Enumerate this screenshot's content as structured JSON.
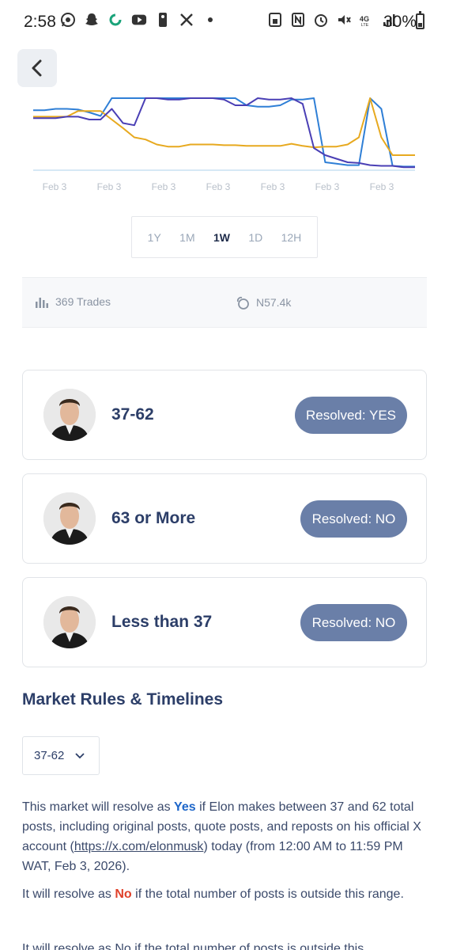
{
  "status": {
    "time": "2:58",
    "battery": "30%",
    "battery_level": 0.3,
    "left_icons": [
      "whatsapp-icon",
      "snapchat-icon",
      "sync-icon",
      "youtube-icon",
      "nba-icon",
      "x-icon",
      "dot-icon"
    ],
    "right_icons": [
      "save-icon",
      "nfc-icon",
      "alarm-icon",
      "mute-icon",
      "4g-icon",
      "signal-icon"
    ]
  },
  "back_icon": "chevron-left-icon",
  "chart_data": {
    "type": "line",
    "x_tick_labels": [
      "Feb 3",
      "Feb 3",
      "Feb 3",
      "Feb 3",
      "Feb 3",
      "Feb 3",
      "Feb 3"
    ],
    "series": [
      {
        "color": "#2f7fd6",
        "values": [
          0.83,
          0.83,
          0.85,
          0.85,
          0.84,
          0.8,
          0.75,
          1.0,
          1.0,
          1.0,
          1.0,
          1.0,
          1.0,
          1.0,
          1.0,
          1.0,
          1.0,
          1.0,
          1.0,
          0.9,
          0.88,
          0.88,
          0.9,
          0.98,
          0.98,
          1.0,
          0.1,
          0.08,
          0.06,
          0.06,
          1.0,
          0.85,
          0.05,
          0.04,
          0.04
        ]
      },
      {
        "color": "#e7a91f",
        "values": [
          0.74,
          0.74,
          0.74,
          0.74,
          0.82,
          0.82,
          0.82,
          0.7,
          0.58,
          0.45,
          0.42,
          0.35,
          0.32,
          0.32,
          0.35,
          0.35,
          0.35,
          0.34,
          0.34,
          0.33,
          0.33,
          0.33,
          0.33,
          0.36,
          0.33,
          0.31,
          0.32,
          0.32,
          0.35,
          0.45,
          1.0,
          0.45,
          0.2,
          0.2,
          0.2
        ]
      },
      {
        "color": "#4a3fb5",
        "values": [
          0.72,
          0.72,
          0.72,
          0.74,
          0.74,
          0.7,
          0.7,
          0.85,
          0.65,
          0.62,
          1.0,
          1.0,
          0.98,
          0.98,
          1.0,
          1.0,
          1.0,
          0.98,
          0.9,
          0.9,
          1.0,
          0.98,
          0.98,
          1.0,
          0.92,
          0.3,
          0.2,
          0.15,
          0.1,
          0.09,
          0.06,
          0.05,
          0.05,
          0.03,
          0.03
        ]
      }
    ]
  },
  "ranges": [
    {
      "label": "1Y",
      "active": false
    },
    {
      "label": "1M",
      "active": false
    },
    {
      "label": "1W",
      "active": true
    },
    {
      "label": "1D",
      "active": false
    },
    {
      "label": "12H",
      "active": false
    }
  ],
  "stats": {
    "trades": "369 Trades",
    "trades_icon": "bar-chart-icon",
    "volume": "N57.4k",
    "volume_icon": "coins-icon"
  },
  "outcomes": [
    {
      "label": "37-62",
      "status": "Resolved: YES",
      "avatar": "avatar"
    },
    {
      "label": "63 or More",
      "status": "Resolved: NO",
      "avatar": "avatar"
    },
    {
      "label": "Less than 37",
      "status": "Resolved: NO",
      "avatar": "avatar"
    }
  ],
  "rules": {
    "title": "Market Rules & Timelines",
    "selected_outcome": "37-62",
    "para1_pre": "This market will resolve as ",
    "para1_yes": "Yes",
    "para1_mid": " if Elon makes between 37 and 62 total posts, including original posts, quote posts, and reposts on his official X account (",
    "para1_link": "https://x.com/elonmusk",
    "para1_post": ") today (from 12:00 AM to 11:59 PM WAT, Feb 3, 2026).",
    "para2_pre": "It will resolve as ",
    "para2_no": "No",
    "para2_post": " if the total number of posts is outside this range.",
    "para3_cut": "It will resolve as No if the total number of posts is outside this"
  }
}
